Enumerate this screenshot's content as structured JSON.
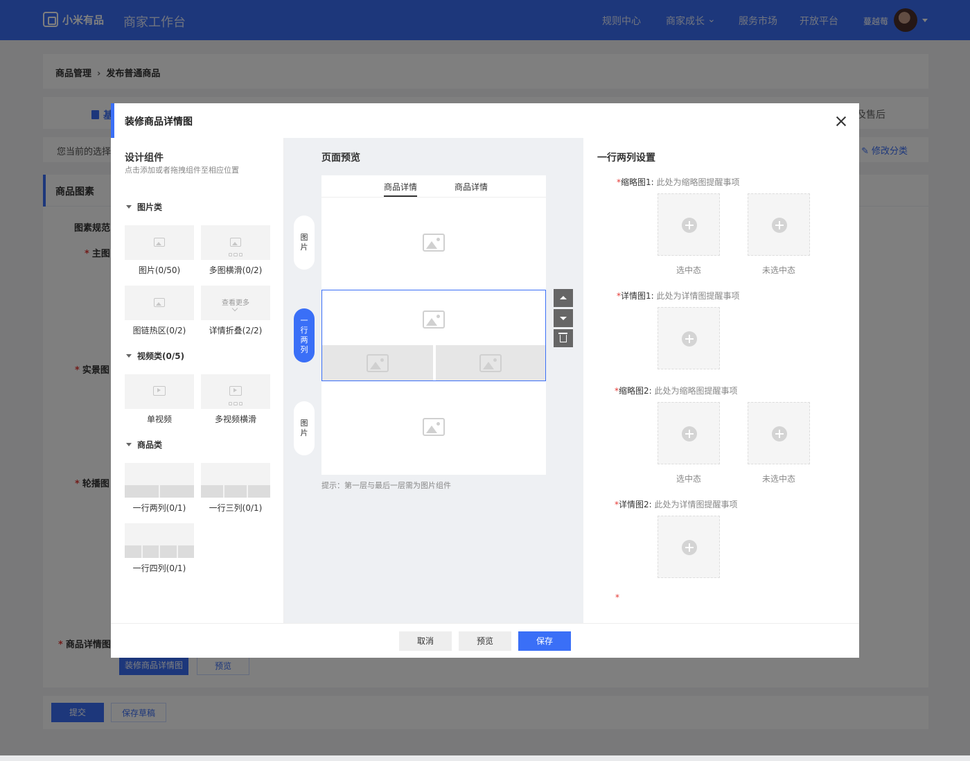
{
  "header": {
    "logo_text": "小米有品",
    "app_title": "商家工作台",
    "nav": [
      "规则中心",
      "商家成长",
      "服务市场",
      "开放平台"
    ],
    "user_name": "蔓越莓"
  },
  "breadcrumb": {
    "parent": "商品管理",
    "current": "发布普通商品"
  },
  "bg_tabs": {
    "first_partial": "基",
    "last_partial": "及售后"
  },
  "category_info": {
    "text_partial": "您当前的选择",
    "edit_link": "修改分类"
  },
  "bg_section": {
    "title": "商品图素",
    "spec_partial": "图素规范",
    "labels": [
      "主图",
      "实景图",
      "轮播图",
      "商品详情图"
    ],
    "decorate_button": "装修商品详情图",
    "preview_button": "预览"
  },
  "bottom_actions": {
    "submit": "提交",
    "save_draft": "保存草稿"
  },
  "modal": {
    "title": "装修商品详情图",
    "left": {
      "title": "设计组件",
      "subtitle": "点击添加或者拖拽组件至相应位置",
      "groups": {
        "image": "图片类",
        "video": "视频类(0/5)",
        "product": "商品类"
      },
      "components": {
        "image": "图片(0/50)",
        "multi_image": "多图横滑(0/2)",
        "hotspot": "图链热区(0/2)",
        "fold": "详情折叠(2/2)",
        "fold_thumb_text": "查看更多",
        "single_video": "单视频",
        "multi_video": "多视频横滑",
        "row2": "一行两列(0/1)",
        "row3": "一行三列(0/1)",
        "row4": "一行四列(0/1)"
      }
    },
    "middle": {
      "title": "页面预览",
      "tabs": [
        "商品详情",
        "商品详情"
      ],
      "side_tags": {
        "first": "图片",
        "selected": "一行两列",
        "last": "图片"
      },
      "hint": "提示：第一层与最后一层需为图片组件"
    },
    "right": {
      "title": "一行两列设置",
      "fields": {
        "thumb1_label": "缩略图1:",
        "thumb1_hint": "此处为缩略图提醒事项",
        "detail1_label": "详情图1:",
        "detail1_hint": "此处为详情图提醒事项",
        "thumb2_label": "缩略图2:",
        "thumb2_hint": "此处为缩略图提醒事项",
        "detail2_label": "详情图2:",
        "detail2_hint": "此处为详情图提醒事项"
      },
      "captions": {
        "selected": "选中态",
        "unselected": "未选中态"
      },
      "required_mark": "*"
    },
    "footer": {
      "cancel": "取消",
      "preview": "预览",
      "save": "保存"
    }
  }
}
